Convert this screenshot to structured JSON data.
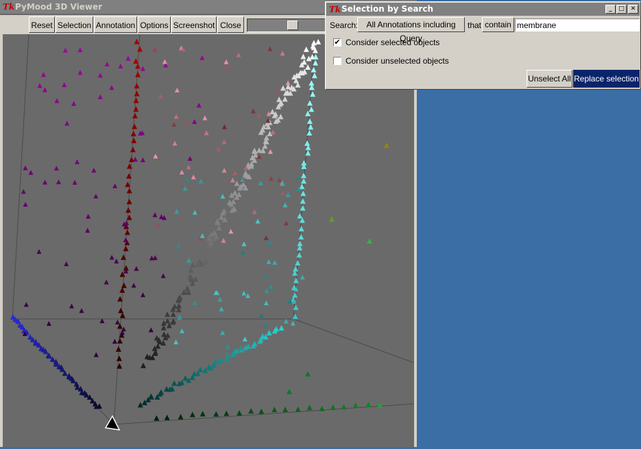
{
  "viewer": {
    "title": "PyMood 3D Viewer",
    "toolbar": [
      "Reset",
      "Selection",
      "Annotation",
      "Options",
      "Screenshot",
      "Close"
    ],
    "slider_level": 0.6
  },
  "search_dialog": {
    "title": "Selection by Search",
    "search_label": "Search:",
    "scope_button": "All Annotations including Query",
    "that_label": "that",
    "op_button": "contain",
    "query_value": "membrane",
    "consider_selected": {
      "label": "Consider selected objects",
      "checked": true,
      "mark": "✔"
    },
    "consider_unselected": {
      "label": "Consider unselected objects",
      "checked": false
    },
    "unselect_all": "Unselect All",
    "replace_selection": "Replace selection"
  },
  "colors": {
    "desktop": "#3a6ea5",
    "canvas": "#6a6a6a",
    "primary_button": "#0a246a"
  },
  "icons": {
    "app": "tk-icon",
    "minimize": "minimize-icon",
    "maximize": "maximize-icon",
    "close": "close-icon"
  }
}
